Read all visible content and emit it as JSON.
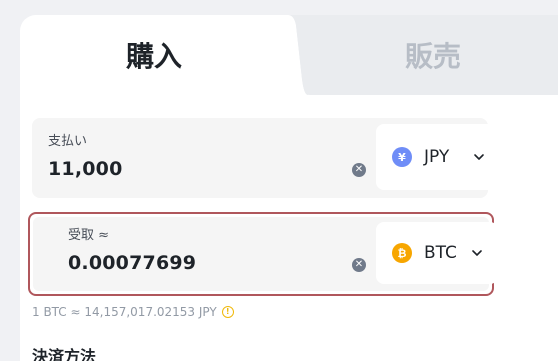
{
  "tabs": {
    "buy_label": "購入",
    "sell_label": "販売"
  },
  "pay": {
    "label": "支払い",
    "value": "11,000",
    "currency": "JPY",
    "currency_icon_glyph": "¥",
    "currency_icon": "yen-icon",
    "currency_color": "#6f8df7"
  },
  "receive": {
    "label": "受取 ≈",
    "value": "0.00077699",
    "currency": "BTC",
    "currency_icon_glyph": "₿",
    "currency_icon": "bitcoin-icon",
    "currency_color": "#f7a600"
  },
  "rate_text": "1 BTC ≈ 14,157,017.02153 JPY",
  "payment_method_title": "決済方法",
  "colors": {
    "highlight_border": "#b0575c",
    "warning": "#f0b90b"
  }
}
